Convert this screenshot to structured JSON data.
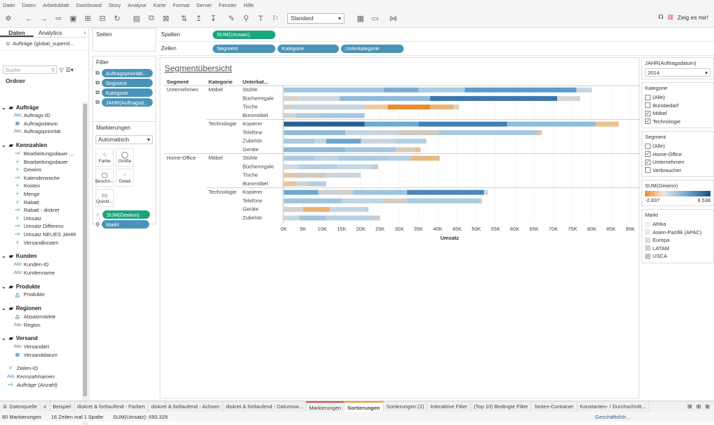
{
  "menu": [
    "Datei",
    "Daten",
    "Arbeitsblatt",
    "Dashboard",
    "Story",
    "Analyse",
    "Karte",
    "Format",
    "Server",
    "Fenster",
    "Hilfe"
  ],
  "toolbar": {
    "fit_select": "Standard",
    "help_label": "Zeig es mir!"
  },
  "left": {
    "tabs": [
      "Daten",
      "Analytics"
    ],
    "datasource": "Aufträge (global_superst...",
    "search_placeholder": "Suche",
    "ordner_label": "Ordner",
    "groups": [
      {
        "name": "Aufträge",
        "fields": [
          {
            "t": "Abc",
            "n": "Auftrags-ID"
          },
          {
            "t": "▦",
            "n": "Auftragsdatum"
          },
          {
            "t": "Abc",
            "n": "Auftragspriorität"
          }
        ]
      },
      {
        "name": "Kennzahlen",
        "fields": [
          {
            "t": "=#",
            "n": "Bearbeitungsdauer ..."
          },
          {
            "t": "#",
            "n": "Bearbeitungsdauer"
          },
          {
            "t": "#",
            "n": "Gewinn"
          },
          {
            "t": "=#",
            "n": "Kalenderwoche"
          },
          {
            "t": "#",
            "n": "Kosten"
          },
          {
            "t": "#",
            "n": "Menge"
          },
          {
            "t": "#",
            "n": "Rabatt"
          },
          {
            "t": "=#",
            "n": "Rabatt - diskret"
          },
          {
            "t": "#",
            "n": "Umsatz"
          },
          {
            "t": "=#",
            "n": "Umsatz Differenz"
          },
          {
            "t": "=#",
            "n": "Umsatz NEUES JAHR"
          },
          {
            "t": "#",
            "n": "Versandkosten"
          }
        ]
      },
      {
        "name": "Kunden",
        "fields": [
          {
            "t": "Abc",
            "n": "Kunden-ID"
          },
          {
            "t": "Abc",
            "n": "Kundenname"
          }
        ]
      },
      {
        "name": "Produkte",
        "fields": [
          {
            "t": "品",
            "n": "Produkte"
          }
        ]
      },
      {
        "name": "Regionen",
        "fields": [
          {
            "t": "品",
            "n": "Absatzmärkte"
          },
          {
            "t": "Abc",
            "n": "Region"
          }
        ]
      },
      {
        "name": "Versand",
        "fields": [
          {
            "t": "Abc",
            "n": "Versandart"
          },
          {
            "t": "▦",
            "n": "Versanddatum"
          }
        ]
      }
    ],
    "extra_fields": [
      {
        "t": "#",
        "n": "Zeilen-ID"
      },
      {
        "t": "Abc",
        "n": "Kennzahlnamen"
      },
      {
        "t": "=#",
        "n": "Aufträge (Anzahl)"
      }
    ]
  },
  "pages_label": "Seiten",
  "filter": {
    "label": "Filter",
    "pills": [
      "Auftragspriorität...",
      "Segment",
      "Kategorie",
      "JAHR(Auftragsd..."
    ]
  },
  "marks": {
    "label": "Markierungen",
    "type": "Automatisch",
    "buttons": [
      "Farbe",
      "Größe",
      "Beschri...",
      "Detail",
      "QuickI..."
    ],
    "pills": [
      "SUM(Gewinn)",
      "Markt"
    ]
  },
  "shelves": {
    "columns_label": "Spalten",
    "columns_pill": "SUM(Umsatz)",
    "rows_label": "Zeilen",
    "rows_pills": [
      "Segment",
      "Kategorie",
      "Unterkategorie"
    ]
  },
  "chart_data": {
    "type": "bar",
    "title": "Segmentübersicht",
    "headers": [
      "Segment",
      "Kategorie",
      "Unterkat..."
    ],
    "xlabel": "Umsatz",
    "xticks": [
      "0K",
      "5K",
      "10K",
      "15K",
      "20K",
      "25K",
      "30K",
      "35K",
      "40K",
      "45K",
      "50K",
      "55K",
      "60K",
      "65K",
      "70K",
      "75K",
      "80K",
      "85K",
      "90K"
    ],
    "xlim": [
      0,
      90000
    ],
    "rows": [
      {
        "segment": "Unternehmen",
        "kategorie": "Möbel",
        "sub": "Stühle",
        "segs": [
          [
            0,
            9000,
            "#9ec6e0"
          ],
          [
            9000,
            26000,
            "#9ec6e0"
          ],
          [
            26000,
            35000,
            "#7aaed4"
          ],
          [
            35000,
            47000,
            "#a9cbe3"
          ],
          [
            47000,
            76000,
            "#5b9cc9"
          ],
          [
            76000,
            80000,
            "#c7d5df"
          ]
        ]
      },
      {
        "segment": "",
        "kategorie": "",
        "sub": "Bücherregale",
        "segs": [
          [
            0,
            4000,
            "#d9d2c8"
          ],
          [
            4000,
            14500,
            "#c9d8e3"
          ],
          [
            14500,
            38000,
            "#8fbbd9"
          ],
          [
            38000,
            71000,
            "#3a77ab"
          ],
          [
            71000,
            77000,
            "#d6d6d6"
          ]
        ]
      },
      {
        "segment": "",
        "kategorie": "",
        "sub": "Tische",
        "segs": [
          [
            0,
            2000,
            "#cfcfcf"
          ],
          [
            2000,
            21000,
            "#c4d4e0"
          ],
          [
            21000,
            27000,
            "#eec9a0"
          ],
          [
            27000,
            38000,
            "#e88a2e"
          ],
          [
            38000,
            44000,
            "#e9b27a"
          ],
          [
            44000,
            45500,
            "#d9d2c8"
          ]
        ]
      },
      {
        "segment": "",
        "kategorie": "",
        "sub": "Büromöbel",
        "segs": [
          [
            0,
            3000,
            "#d2d2d2"
          ],
          [
            3000,
            9000,
            "#b7c9d6"
          ],
          [
            9000,
            21000,
            "#a7c8e0"
          ]
        ]
      },
      {
        "segment": "",
        "kategorie": "Technologie",
        "sub": "Kopierer",
        "segs": [
          [
            0,
            21000,
            "#2a5f92"
          ],
          [
            21000,
            35000,
            "#6ea8d0"
          ],
          [
            35000,
            58000,
            "#3f7fb5"
          ],
          [
            58000,
            81000,
            "#8fbcdc"
          ],
          [
            81000,
            87000,
            "#f0c08c"
          ]
        ]
      },
      {
        "segment": "",
        "kategorie": "",
        "sub": "Telefone",
        "segs": [
          [
            0,
            16000,
            "#8fbbd9"
          ],
          [
            16000,
            30000,
            "#c6d4df"
          ],
          [
            30000,
            40000,
            "#cfcabe"
          ],
          [
            40000,
            66000,
            "#a8c9e0"
          ],
          [
            66000,
            67000,
            "#e0c8a8"
          ]
        ]
      },
      {
        "segment": "",
        "kategorie": "",
        "sub": "Zubehör",
        "segs": [
          [
            0,
            8000,
            "#a6c8e0"
          ],
          [
            8000,
            11000,
            "#c0d6e6"
          ],
          [
            11000,
            20000,
            "#6ea5cf"
          ],
          [
            20000,
            29000,
            "#c9d6df"
          ],
          [
            29000,
            37000,
            "#b3d0e5"
          ]
        ]
      },
      {
        "segment": "",
        "kategorie": "",
        "sub": "Geräte",
        "segs": [
          [
            0,
            16000,
            "#8cbad9"
          ],
          [
            16000,
            29000,
            "#a6c6dd"
          ],
          [
            29000,
            34000,
            "#d9ccb8"
          ],
          [
            34000,
            35500,
            "#e7bf93"
          ]
        ]
      },
      {
        "segment": "Home-Office",
        "kategorie": "Möbel",
        "sub": "Stühle",
        "segs": [
          [
            0,
            8000,
            "#a9cae2"
          ],
          [
            8000,
            14000,
            "#c0d4e2"
          ],
          [
            14000,
            27000,
            "#a9cae2"
          ],
          [
            27000,
            33000,
            "#b4cee2"
          ],
          [
            33000,
            40500,
            "#e4b986"
          ]
        ]
      },
      {
        "segment": "",
        "kategorie": "",
        "sub": "Bücherregale",
        "segs": [
          [
            0,
            4000,
            "#cdd9e3"
          ],
          [
            4000,
            14000,
            "#b5cfe3"
          ],
          [
            14000,
            23000,
            "#c5d8e6"
          ],
          [
            23000,
            24500,
            "#c9c9c9"
          ]
        ]
      },
      {
        "segment": "",
        "kategorie": "",
        "sub": "Tische",
        "segs": [
          [
            0,
            3000,
            "#e5c7a3"
          ],
          [
            3000,
            11000,
            "#cfcabf"
          ],
          [
            11000,
            20000,
            "#c9d6df"
          ]
        ]
      },
      {
        "segment": "",
        "kategorie": "",
        "sub": "Büromöbel",
        "segs": [
          [
            0,
            3000,
            "#e8c49a"
          ],
          [
            3000,
            6000,
            "#d3d3d3"
          ],
          [
            6000,
            11000,
            "#b5cee0"
          ]
        ]
      },
      {
        "segment": "",
        "kategorie": "Technologie",
        "sub": "Kopierer",
        "segs": [
          [
            0,
            9000,
            "#6ea8d0"
          ],
          [
            9000,
            18000,
            "#d0d0d0"
          ],
          [
            18000,
            32000,
            "#9ec4df"
          ],
          [
            32000,
            52000,
            "#4a88bd"
          ],
          [
            52000,
            53000,
            "#c7d5df"
          ]
        ]
      },
      {
        "segment": "",
        "kategorie": "",
        "sub": "Telefone",
        "segs": [
          [
            0,
            15000,
            "#9ec4df"
          ],
          [
            15000,
            26000,
            "#c0d4e2"
          ],
          [
            26000,
            32000,
            "#d4cdc2"
          ],
          [
            32000,
            51000,
            "#a9cbe3"
          ],
          [
            51000,
            51500,
            "#cfcfcf"
          ]
        ]
      },
      {
        "segment": "",
        "kategorie": "",
        "sub": "Geräte",
        "segs": [
          [
            0,
            5000,
            "#d1d1d1"
          ],
          [
            5000,
            12000,
            "#e9b071"
          ],
          [
            12000,
            21000,
            "#c4d5e2"
          ],
          [
            21000,
            22000,
            "#cccccc"
          ]
        ]
      },
      {
        "segment": "",
        "kategorie": "",
        "sub": "Zubehör",
        "segs": [
          [
            0,
            4000,
            "#c9d6df"
          ],
          [
            4000,
            11000,
            "#9ec4df"
          ],
          [
            11000,
            23000,
            "#b8d0e3"
          ],
          [
            23000,
            25000,
            "#cccccc"
          ]
        ]
      }
    ]
  },
  "right": {
    "year": {
      "label": "JAHR(Auftragsdatum)",
      "value": "2014"
    },
    "kategorie": {
      "label": "Kategorie",
      "items": [
        {
          "n": "(Alle)",
          "c": false
        },
        {
          "n": "Bürobedarf",
          "c": false
        },
        {
          "n": "Möbel",
          "c": true
        },
        {
          "n": "Technologie",
          "c": true
        }
      ]
    },
    "segment": {
      "label": "Segment",
      "items": [
        {
          "n": "(Alle)",
          "c": false
        },
        {
          "n": "Home-Office",
          "c": true
        },
        {
          "n": "Unternehmen",
          "c": true
        },
        {
          "n": "Verbraucher",
          "c": false
        }
      ]
    },
    "gewinn": {
      "label": "SUM(Gewinn)",
      "min": "-2.837",
      "max": "9.538"
    },
    "markt": {
      "label": "Markt",
      "items": [
        {
          "n": "Afrika",
          "col": "#f2f2f2"
        },
        {
          "n": "Asien-Pazifik (APAC)",
          "col": "#ececec"
        },
        {
          "n": "Europa",
          "col": "#dddddd"
        },
        {
          "n": "LATAM",
          "col": "#d0d0d0"
        },
        {
          "n": "USCA",
          "col": "#c2c2c2"
        }
      ]
    }
  },
  "tabs": [
    "Datenquelle",
    "n",
    "Beispiel",
    "diskret & fortlaufend - Farben",
    "diskret & fortlaufend - Achsen",
    "diskret & fortlaufend - Datumsw...",
    "Markierungen",
    "Sortierungen",
    "Sortierungen (2)",
    "Interaktive Filter",
    "(Top 10) Bedingte Filter",
    "Seiten-Container",
    "Konstanten- / Durchschnitt..."
  ],
  "active_tab": "Sortierungen",
  "status": {
    "marks": "80 Markierungen",
    "rows": "16 Zeilen mal 1 Spalte",
    "sum": "SUM(Umsatz): 693.329",
    "user": "Geschäftsfüh..."
  }
}
